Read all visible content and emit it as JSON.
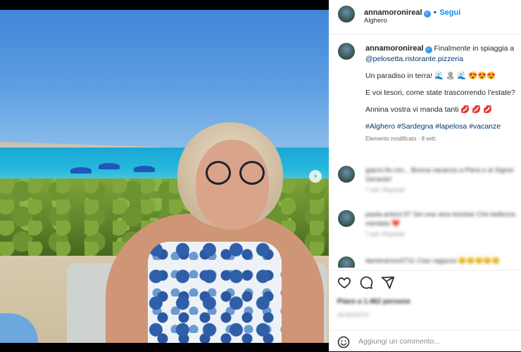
{
  "post": {
    "username": "annamoronireal",
    "follow_label": "Segui",
    "location": "Alghero",
    "separator": "•"
  },
  "caption": {
    "username": "annamoronireal",
    "line1": "Finalmente in spiaggia a",
    "mention": "@pelosetta.ristorante.pizzeria",
    "line2": "Un paradiso in terra! 🌊 🏝 🌊 😍😍😍",
    "line3": "E voi tesori, come state trascorrendo l'estate?",
    "line4": "Annina vostra vi manda tanti 💋 💋 💋",
    "hashtags": [
      "#Alghero",
      "#Sardegna",
      "#lapelosa",
      "#vacanze"
    ],
    "edited": "Elemento modificato",
    "age": "8 sett."
  },
  "comments": [
    {
      "text": "gianni.fio.ren...  Buona vacanza a Piera e al Signor Gerardo!",
      "meta": "7 sett.   Rispondi"
    },
    {
      "text": "paola.antoni.97  Sei una vera bomba! Che bellezza meritata ❤️",
      "meta": "7 sett.   Rispondi"
    },
    {
      "text": "danieramon0711  Ciao ragazza 😊😊😊😊😊",
      "meta": ""
    }
  ],
  "actions": {
    "likes_text": "Piace a 1.462 persone",
    "date_text": "26 AGOSTO"
  },
  "add_comment": {
    "placeholder": "Aggiungi un commento..."
  },
  "icons": [
    "heart-icon",
    "comment-icon",
    "share-icon",
    "emoji-icon",
    "next-arrow-icon"
  ],
  "colors": {
    "accent": "#0095f6",
    "verified": "#3897f0",
    "hashtag": "#00376b"
  }
}
